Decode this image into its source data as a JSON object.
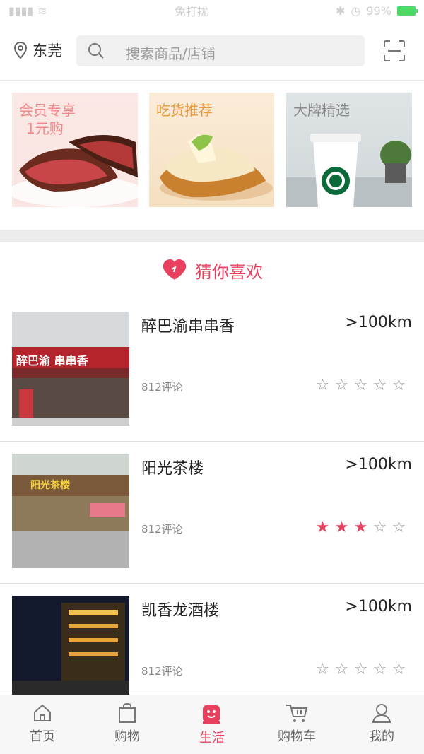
{
  "status_bar": {
    "carrier_time": "免打扰",
    "battery": "99%"
  },
  "header": {
    "city": "东莞",
    "search_placeholder": "搜索商品/店铺"
  },
  "banners": [
    {
      "title_line1": "会员专享",
      "title_line2": "1元购"
    },
    {
      "title_line1": "吃货推荐",
      "title_line2": ""
    },
    {
      "title_line1": "大牌精选",
      "title_line2": ""
    }
  ],
  "section": {
    "title": "猜你喜欢"
  },
  "shops": [
    {
      "name": "醉巴渝串串香",
      "distance": ">100km",
      "reviews": "812评论",
      "rating": 0,
      "sign": "醉巴渝 串串香"
    },
    {
      "name": "阳光茶楼",
      "distance": ">100km",
      "reviews": "812评论",
      "rating": 3,
      "sign": "阳光茶楼"
    },
    {
      "name": "凯香龙酒楼",
      "distance": ">100km",
      "reviews": "812评论",
      "rating": 0,
      "sign": ""
    }
  ],
  "tabs": [
    {
      "label": "首页",
      "icon": "home-icon",
      "active": false
    },
    {
      "label": "购物",
      "icon": "shopping-bag-icon",
      "active": false
    },
    {
      "label": "生活",
      "icon": "cup-smile-icon",
      "active": true
    },
    {
      "label": "购物车",
      "icon": "cart-icon",
      "active": false
    },
    {
      "label": "我的",
      "icon": "user-icon",
      "active": false
    }
  ],
  "colors": {
    "accent": "#e8405e",
    "star_off": "#999999",
    "bg_gap": "#ececec"
  }
}
